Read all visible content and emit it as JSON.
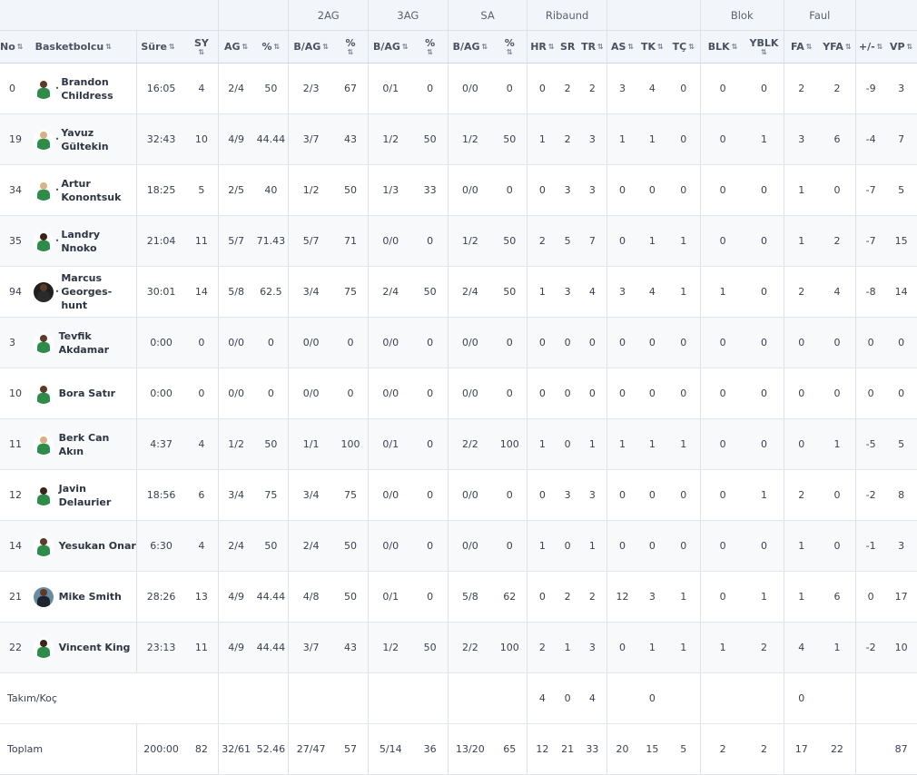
{
  "groups": {
    "ag2": "2AG",
    "ag3": "3AG",
    "sa": "SA",
    "ribaund": "Ribaund",
    "blok": "Blok",
    "faul": "Faul"
  },
  "columns": {
    "no": "No",
    "player": "Basketbolcu",
    "sure": "Süre",
    "sy": "SY",
    "ag": "AG",
    "pct": "%",
    "b_ag": "B/AG",
    "hr": "HR",
    "sr": "SR",
    "tr": "TR",
    "as": "AS",
    "tk": "TK",
    "tc": "TÇ",
    "blk": "BLK",
    "yblk": "YBLK",
    "fa": "FA",
    "yfa": "YFA",
    "pm": "+/-",
    "vp": "VP"
  },
  "players": [
    {
      "no": "0",
      "name": "Brandon Childress",
      "star": true,
      "sure": "16:05",
      "sy": "4",
      "ag": "2/4",
      "agp": "50",
      "ag2": "2/3",
      "ag2p": "67",
      "ag3": "0/1",
      "ag3p": "0",
      "sa": "0/0",
      "sap": "0",
      "hr": "0",
      "sr": "2",
      "tr": "2",
      "as": "3",
      "tk": "4",
      "tc": "0",
      "blk": "0",
      "yblk": "0",
      "fa": "2",
      "yfa": "2",
      "pm": "-9",
      "vp": "3"
    },
    {
      "no": "19",
      "name": "Yavuz Gültekin",
      "star": true,
      "sure": "32:43",
      "sy": "10",
      "ag": "4/9",
      "agp": "44.44",
      "ag2": "3/7",
      "ag2p": "43",
      "ag3": "1/2",
      "ag3p": "50",
      "sa": "1/2",
      "sap": "50",
      "hr": "1",
      "sr": "2",
      "tr": "3",
      "as": "1",
      "tk": "1",
      "tc": "0",
      "blk": "0",
      "yblk": "1",
      "fa": "3",
      "yfa": "6",
      "pm": "-4",
      "vp": "7"
    },
    {
      "no": "34",
      "name": "Artur Konontsuk",
      "star": true,
      "sure": "18:25",
      "sy": "5",
      "ag": "2/5",
      "agp": "40",
      "ag2": "1/2",
      "ag2p": "50",
      "ag3": "1/3",
      "ag3p": "33",
      "sa": "0/0",
      "sap": "0",
      "hr": "0",
      "sr": "3",
      "tr": "3",
      "as": "0",
      "tk": "0",
      "tc": "0",
      "blk": "0",
      "yblk": "0",
      "fa": "1",
      "yfa": "0",
      "pm": "-7",
      "vp": "5"
    },
    {
      "no": "35",
      "name": "Landry Nnoko",
      "star": true,
      "sure": "21:04",
      "sy": "11",
      "ag": "5/7",
      "agp": "71.43",
      "ag2": "5/7",
      "ag2p": "71",
      "ag3": "0/0",
      "ag3p": "0",
      "sa": "1/2",
      "sap": "50",
      "hr": "2",
      "sr": "5",
      "tr": "7",
      "as": "0",
      "tk": "1",
      "tc": "1",
      "blk": "0",
      "yblk": "0",
      "fa": "1",
      "yfa": "2",
      "pm": "-7",
      "vp": "15"
    },
    {
      "no": "94",
      "name": "Marcus Georges-hunt",
      "star": true,
      "sure": "30:01",
      "sy": "14",
      "ag": "5/8",
      "agp": "62.5",
      "ag2": "3/4",
      "ag2p": "75",
      "ag3": "2/4",
      "ag3p": "50",
      "sa": "2/4",
      "sap": "50",
      "hr": "1",
      "sr": "3",
      "tr": "4",
      "as": "3",
      "tk": "4",
      "tc": "1",
      "blk": "1",
      "yblk": "0",
      "fa": "2",
      "yfa": "4",
      "pm": "-8",
      "vp": "14"
    },
    {
      "no": "3",
      "name": "Tevfik Akdamar",
      "star": false,
      "sure": "0:00",
      "sy": "0",
      "ag": "0/0",
      "agp": "0",
      "ag2": "0/0",
      "ag2p": "0",
      "ag3": "0/0",
      "ag3p": "0",
      "sa": "0/0",
      "sap": "0",
      "hr": "0",
      "sr": "0",
      "tr": "0",
      "as": "0",
      "tk": "0",
      "tc": "0",
      "blk": "0",
      "yblk": "0",
      "fa": "0",
      "yfa": "0",
      "pm": "0",
      "vp": "0"
    },
    {
      "no": "10",
      "name": "Bora Satır",
      "star": false,
      "sure": "0:00",
      "sy": "0",
      "ag": "0/0",
      "agp": "0",
      "ag2": "0/0",
      "ag2p": "0",
      "ag3": "0/0",
      "ag3p": "0",
      "sa": "0/0",
      "sap": "0",
      "hr": "0",
      "sr": "0",
      "tr": "0",
      "as": "0",
      "tk": "0",
      "tc": "0",
      "blk": "0",
      "yblk": "0",
      "fa": "0",
      "yfa": "0",
      "pm": "0",
      "vp": "0"
    },
    {
      "no": "11",
      "name": "Berk Can Akın",
      "star": false,
      "sure": "4:37",
      "sy": "4",
      "ag": "1/2",
      "agp": "50",
      "ag2": "1/1",
      "ag2p": "100",
      "ag3": "0/1",
      "ag3p": "0",
      "sa": "2/2",
      "sap": "100",
      "hr": "1",
      "sr": "0",
      "tr": "1",
      "as": "1",
      "tk": "1",
      "tc": "1",
      "blk": "0",
      "yblk": "0",
      "fa": "0",
      "yfa": "1",
      "pm": "-5",
      "vp": "5"
    },
    {
      "no": "12",
      "name": "Javin Delaurier",
      "star": false,
      "sure": "18:56",
      "sy": "6",
      "ag": "3/4",
      "agp": "75",
      "ag2": "3/4",
      "ag2p": "75",
      "ag3": "0/0",
      "ag3p": "0",
      "sa": "0/0",
      "sap": "0",
      "hr": "0",
      "sr": "3",
      "tr": "3",
      "as": "0",
      "tk": "0",
      "tc": "0",
      "blk": "0",
      "yblk": "1",
      "fa": "2",
      "yfa": "0",
      "pm": "-2",
      "vp": "8"
    },
    {
      "no": "14",
      "name": "Yesukan Onar",
      "star": false,
      "sure": "6:30",
      "sy": "4",
      "ag": "2/4",
      "agp": "50",
      "ag2": "2/4",
      "ag2p": "50",
      "ag3": "0/0",
      "ag3p": "0",
      "sa": "0/0",
      "sap": "0",
      "hr": "1",
      "sr": "0",
      "tr": "1",
      "as": "0",
      "tk": "0",
      "tc": "0",
      "blk": "0",
      "yblk": "0",
      "fa": "1",
      "yfa": "0",
      "pm": "-1",
      "vp": "3"
    },
    {
      "no": "21",
      "name": "Mike Smith",
      "star": false,
      "sure": "28:26",
      "sy": "13",
      "ag": "4/9",
      "agp": "44.44",
      "ag2": "4/8",
      "ag2p": "50",
      "ag3": "0/1",
      "ag3p": "0",
      "sa": "5/8",
      "sap": "62",
      "hr": "0",
      "sr": "2",
      "tr": "2",
      "as": "12",
      "tk": "3",
      "tc": "1",
      "blk": "0",
      "yblk": "1",
      "fa": "1",
      "yfa": "6",
      "pm": "0",
      "vp": "17"
    },
    {
      "no": "22",
      "name": "Vincent King",
      "star": false,
      "sure": "23:13",
      "sy": "11",
      "ag": "4/9",
      "agp": "44.44",
      "ag2": "3/7",
      "ag2p": "43",
      "ag3": "1/2",
      "ag3p": "50",
      "sa": "2/2",
      "sap": "100",
      "hr": "2",
      "sr": "1",
      "tr": "3",
      "as": "0",
      "tk": "1",
      "tc": "1",
      "blk": "1",
      "yblk": "2",
      "fa": "4",
      "yfa": "1",
      "pm": "-2",
      "vp": "10"
    }
  ],
  "team": {
    "label": "Takım/Koç",
    "hr": "4",
    "sr": "0",
    "tr": "4",
    "tk": "0",
    "fa": "0"
  },
  "total": {
    "label": "Toplam",
    "sure": "200:00",
    "sy": "82",
    "ag": "32/61",
    "agp": "52.46",
    "ag2": "27/47",
    "ag2p": "57",
    "ag3": "5/14",
    "ag3p": "36",
    "sa": "13/20",
    "sap": "65",
    "hr": "12",
    "sr": "21",
    "tr": "33",
    "as": "20",
    "tk": "15",
    "tc": "5",
    "blk": "2",
    "yblk": "2",
    "fa": "17",
    "yfa": "22",
    "vp": "87"
  },
  "colors": {
    "header_bg": "#f2f5f9",
    "row_alt_bg": "#f8f9fb",
    "jersey_green": "#2e8b4a"
  },
  "icons": {
    "sort": "sort-arrows-icon",
    "starter": "starter-star-icon",
    "avatar": "player-avatar-icon"
  }
}
